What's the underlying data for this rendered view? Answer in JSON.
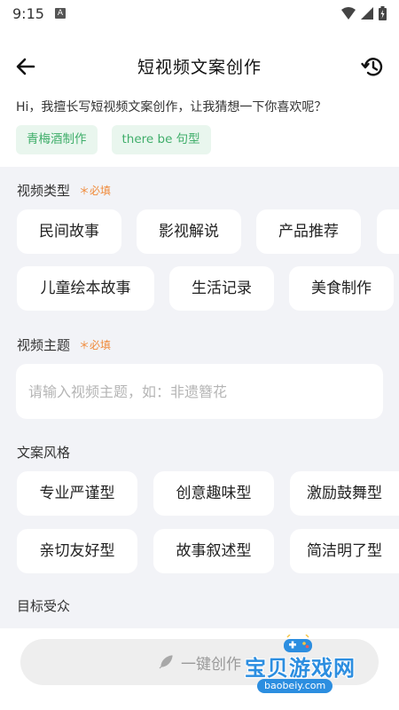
{
  "status_bar": {
    "time": "9:15",
    "a_icon": "A"
  },
  "header": {
    "title": "短视频文案创作"
  },
  "greeting": "Hi，我擅长写短视频文案创作，让我猜想一下你喜欢呢？",
  "suggestions": [
    "青梅酒制作",
    "there be 句型"
  ],
  "video_type": {
    "label": "视频类型",
    "required": "＊必填",
    "options": [
      "民间故事",
      "影视解说",
      "产品推荐",
      "",
      "儿童绘本故事",
      "生活记录",
      "美食制作"
    ]
  },
  "video_topic": {
    "label": "视频主题",
    "required": "＊必填",
    "placeholder": "请输入视频主题，如：非遗簪花"
  },
  "copy_style": {
    "label": "文案风格",
    "options": [
      "专业严谨型",
      "创意趣味型",
      "激励鼓舞型",
      "亲切友好型",
      "故事叙述型",
      "简洁明了型"
    ]
  },
  "target_audience": {
    "label": "目标受众"
  },
  "create_button": {
    "label": "一键创作"
  },
  "watermark": {
    "name": "宝贝游戏网",
    "url": "baobeiy.com"
  },
  "colors": {
    "accent_green": "#3fae6a",
    "required_orange": "#f08a3a",
    "form_bg": "#f2f3f7"
  }
}
